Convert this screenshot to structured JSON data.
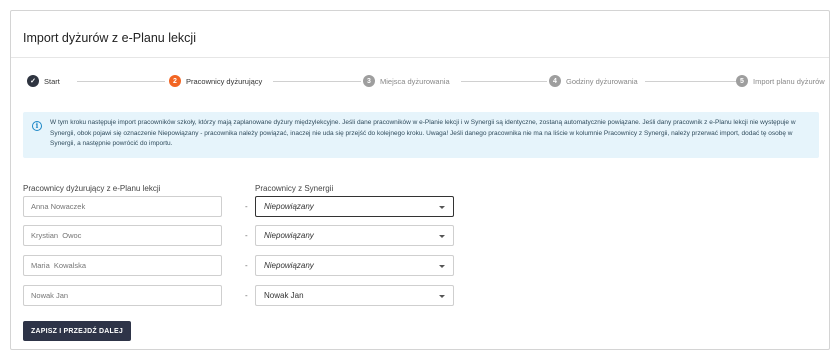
{
  "page": {
    "title": "Import dyżurów z e-Planu lekcji"
  },
  "stepper": {
    "steps": [
      {
        "number": "✓",
        "label": "Start",
        "state": "done"
      },
      {
        "number": "2",
        "label": "Pracownicy dyżurujący",
        "state": "active"
      },
      {
        "number": "3",
        "label": "Miejsca dyżurowania",
        "state": "future"
      },
      {
        "number": "4",
        "label": "Godziny dyżurowania",
        "state": "future"
      },
      {
        "number": "5",
        "label": "Import planu dyżurów",
        "state": "future"
      }
    ],
    "colors": {
      "done": "#2e3440",
      "active": "#f26522",
      "future": "#9e9e9e"
    }
  },
  "info": {
    "icon": "info-icon",
    "text": "W tym kroku następuje import pracowników szkoły, którzy mają zaplanowane dyżury międzylekcyjne. Jeśli dane pracowników w e-Planie lekcji i w Synergii są identyczne, zostaną automatycznie powiązane. Jeśli dany pracownik z e-Planu lekcji nie występuje w Synergii, obok pojawi się oznaczenie Niepowiązany - pracownika należy powiązać, inaczej nie uda się przejść do kolejnego kroku. Uwaga! Jeśli danego pracownika nie ma na liście w kolumnie Pracownicy z Synergii, należy przerwać import, dodać tę osobę w Synergii, a następnie powrócić do importu."
  },
  "columns": {
    "left": "Pracownicy dyżurujący z e-Planu lekcji",
    "right": "Pracownicy z Synergii"
  },
  "rows": [
    {
      "source_placeholder": "Anna Nowaczek",
      "separator": "-",
      "selected": "Niepowiązany"
    },
    {
      "source_placeholder": "Krystian  Owoc",
      "separator": "-",
      "selected": "Niepowiązany"
    },
    {
      "source_placeholder": "Maria  Kowalska",
      "separator": "-",
      "selected": "Niepowiązany"
    },
    {
      "source_placeholder": "Nowak Jan",
      "separator": "-",
      "selected": "Nowak Jan"
    }
  ],
  "actions": {
    "save_label": "ZAPISZ I PRZEJDŹ DALEJ",
    "save_color": "#2e3448"
  }
}
